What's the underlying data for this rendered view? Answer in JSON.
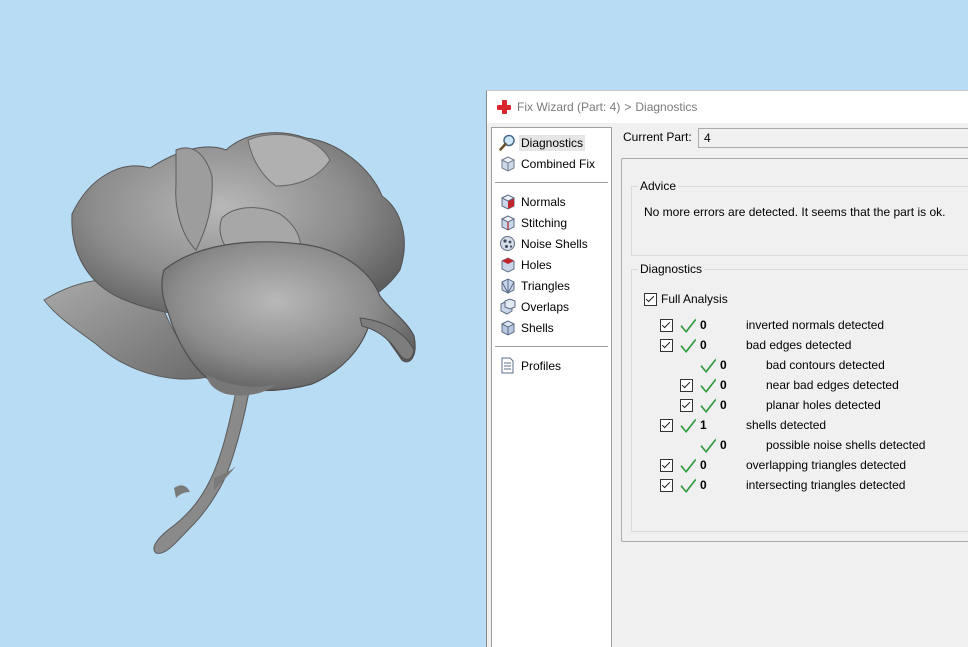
{
  "window": {
    "title": "Fix Wizard (Part: 4)",
    "separator": ">",
    "page": "Diagnostics"
  },
  "nav": {
    "group1": [
      {
        "label": "Diagnostics",
        "icon": "magnifier-icon",
        "selected": true
      },
      {
        "label": "Combined Fix",
        "icon": "combined-fix-icon"
      }
    ],
    "group2": [
      {
        "label": "Normals",
        "icon": "normals-cube-icon"
      },
      {
        "label": "Stitching",
        "icon": "stitching-cube-icon"
      },
      {
        "label": "Noise Shells",
        "icon": "noise-shells-icon"
      },
      {
        "label": "Holes",
        "icon": "holes-cube-icon"
      },
      {
        "label": "Triangles",
        "icon": "triangles-cube-icon"
      },
      {
        "label": "Overlaps",
        "icon": "overlaps-cube-icon"
      },
      {
        "label": "Shells",
        "icon": "shells-cube-icon"
      }
    ],
    "group3": [
      {
        "label": "Profiles",
        "icon": "document-icon"
      }
    ]
  },
  "current_part": {
    "label": "Current Part:",
    "value": "4"
  },
  "advice": {
    "legend": "Advice",
    "text": "No more errors are detected. It seems that the part is ok."
  },
  "diagnostics": {
    "legend": "Diagnostics",
    "full_analysis_label": "Full Analysis",
    "full_analysis_checked": true,
    "rows": [
      {
        "count": "0",
        "label": "inverted normals detected",
        "checkbox": true,
        "indent": 0
      },
      {
        "count": "0",
        "label": "bad edges detected",
        "checkbox": true,
        "indent": 0
      },
      {
        "count": "0",
        "label": "bad contours detected",
        "checkbox": false,
        "indent": 1
      },
      {
        "count": "0",
        "label": "near bad edges detected",
        "checkbox": true,
        "indent": 1
      },
      {
        "count": "0",
        "label": "planar holes detected",
        "checkbox": true,
        "indent": 1
      },
      {
        "count": "1",
        "label": "shells detected",
        "checkbox": true,
        "indent": 0
      },
      {
        "count": "0",
        "label": "possible noise shells detected",
        "checkbox": false,
        "indent": 1
      },
      {
        "count": "0",
        "label": "overlapping triangles detected",
        "checkbox": true,
        "indent": 0
      },
      {
        "count": "0",
        "label": "intersecting triangles detected",
        "checkbox": true,
        "indent": 0
      }
    ]
  },
  "colors": {
    "viewport_bg": "#b9dcf5",
    "tick_green": "#2f9a3c",
    "app_icon_red": "#d8262c"
  }
}
